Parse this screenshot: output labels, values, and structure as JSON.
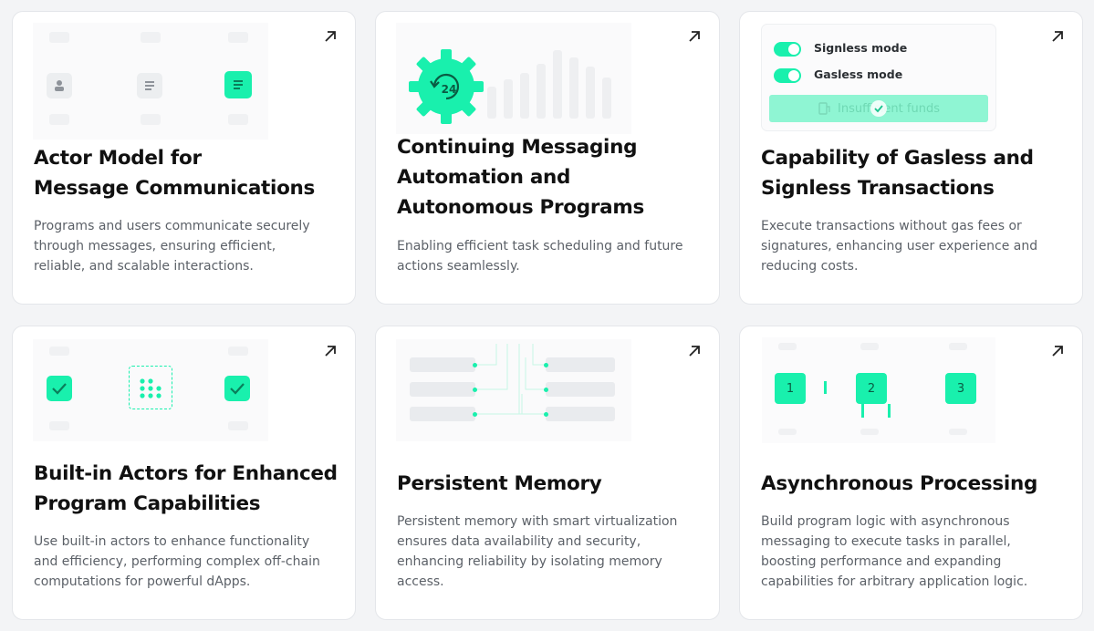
{
  "colors": {
    "accent": "#19f0ad",
    "card_bg": "#ffffff",
    "page_bg": "#f3f4f6",
    "title": "#111111",
    "text": "#5c6168"
  },
  "cards": [
    {
      "title_lines": [
        "Actor Model for",
        "Message Communications"
      ],
      "desc_lines": [
        "Programs and users communicate securely",
        "through messages, ensuring efficient,",
        "reliable, and scalable interactions."
      ],
      "link_icon": "arrow-up-right-icon"
    },
    {
      "title_lines": [
        "Continuing Messaging",
        "Automation and",
        "Autonomous Programs"
      ],
      "desc_lines": [
        "Enabling efficient task scheduling and future",
        "actions seamlessly."
      ],
      "link_icon": "arrow-up-right-icon",
      "gear_label": "24"
    },
    {
      "title_lines": [
        "Capability of Gasless and",
        "Signless Transactions"
      ],
      "desc_lines": [
        "Execute transactions without gas fees or",
        "signatures, enhancing user experience and",
        "reducing costs."
      ],
      "link_icon": "arrow-up-right-icon",
      "toggles": [
        {
          "label": "Signless mode",
          "on": true
        },
        {
          "label": "Gasless mode",
          "on": true
        }
      ],
      "status_button": "Insufficient funds"
    },
    {
      "title_lines": [
        "Built-in Actors for Enhanced",
        "Program Capabilities"
      ],
      "desc_lines": [
        "Use built-in actors to enhance functionality",
        "and efficiency, performing complex off-chain",
        "computations for powerful dApps."
      ],
      "link_icon": "arrow-up-right-icon"
    },
    {
      "title_lines": [
        "Persistent Memory"
      ],
      "desc_lines": [
        "Persistent memory with smart virtualization",
        "ensures data availability and security,",
        "enhancing reliability by isolating memory",
        "access."
      ],
      "link_icon": "arrow-up-right-icon"
    },
    {
      "title_lines": [
        "Asynchronous Processing"
      ],
      "desc_lines": [
        "Build program logic with asynchronous",
        "messaging to execute tasks in parallel,",
        "boosting performance and expanding",
        "capabilities for arbitrary application logic."
      ],
      "link_icon": "arrow-up-right-icon",
      "steps": [
        "1",
        "2",
        "3"
      ]
    }
  ]
}
